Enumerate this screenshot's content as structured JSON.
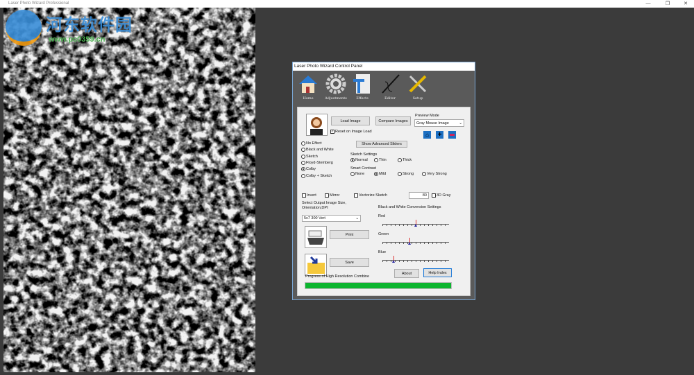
{
  "window": {
    "title": "Laser Photo Wizard Professional",
    "controls": [
      "—",
      "❐",
      "✕"
    ]
  },
  "watermark": {
    "cn": "河东软件园",
    "url": "www.pc0359.cn"
  },
  "panel": {
    "title": "Laser Photo Wizard Control Panel",
    "tools": [
      {
        "label": "Home",
        "icon": "home-icon"
      },
      {
        "label": "Adjustments",
        "icon": "gear-icon"
      },
      {
        "label": "Effects",
        "icon": "effects-icon"
      },
      {
        "label": "Editor",
        "icon": "editor-icon"
      },
      {
        "label": "Setup",
        "icon": "setup-icon"
      }
    ],
    "load_image": "Load Image",
    "compare_images": "Compare Images",
    "preview_mode_label": "Preview Mode",
    "preview_mode_value": "Gray Mouse Image",
    "reset_on_load": "Reset on Image Load",
    "reset_checked": true,
    "show_advanced": "Show Advanced Sliders",
    "effects": [
      {
        "label": "No Effect",
        "on": false
      },
      {
        "label": "Black and White",
        "on": false
      },
      {
        "label": "Sketch",
        "on": false
      },
      {
        "label": "Floyd-Steinberg",
        "on": false
      },
      {
        "label": "Colby",
        "on": true
      },
      {
        "label": "Colby + Sketch",
        "on": false
      }
    ],
    "sketch_settings_label": "Sketch Settings",
    "sketch_settings": [
      {
        "label": "Normal",
        "on": true
      },
      {
        "label": "Thin",
        "on": false
      },
      {
        "label": "Thick",
        "on": false
      }
    ],
    "smart_contrast_label": "Smart Contrast",
    "smart_contrast": [
      {
        "label": "None",
        "on": false
      },
      {
        "label": "Mild",
        "on": true
      },
      {
        "label": "Strong",
        "on": false
      },
      {
        "label": "Very Strong",
        "on": false
      }
    ],
    "invert": "Invert",
    "mirror": "Mirror",
    "vectorize": "Vectorize Sketch",
    "value_box": "80",
    "gray3d": "3D Gray",
    "output_size_label": "Select Output Image Size, Orientation,DPI",
    "output_size_value": "5x7 300 Vert",
    "print": "Print",
    "save": "Save",
    "bw_label": "Black and White Conversion Settings",
    "sliders": [
      {
        "label": "Red",
        "value": 0.5
      },
      {
        "label": "Green",
        "value": 0.41
      },
      {
        "label": "Blue",
        "value": 0.17
      }
    ],
    "about": "About",
    "help": "Help Index",
    "progress_label": "Progress of High Resolution Combine",
    "progress": 1.0,
    "progress_color": "#0cb52f"
  }
}
